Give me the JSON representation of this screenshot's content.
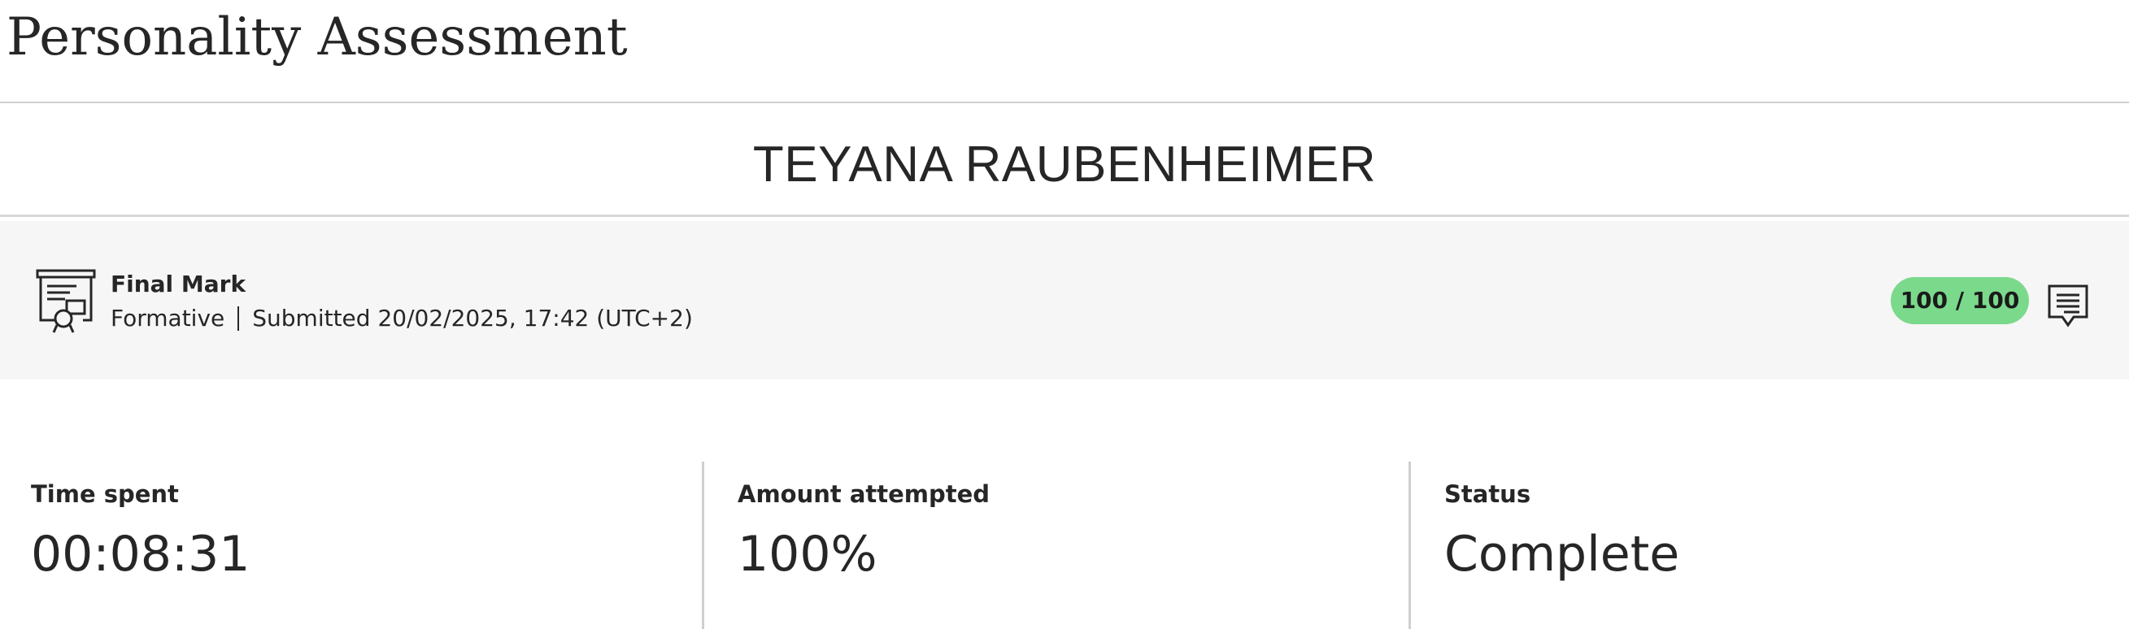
{
  "header": {
    "title": "Personality Assessment"
  },
  "student": {
    "name": "TEYANA RAUBENHEIMER"
  },
  "final_mark": {
    "title": "Final Mark",
    "type": "Formative",
    "submitted": "Submitted 20/02/2025, 17:42 (UTC+2)",
    "score": "100 / 100",
    "score_color": "#7bd98b",
    "icon": "certificate-icon",
    "feedback_icon": "feedback-comment-icon"
  },
  "stats": [
    {
      "label": "Time spent",
      "value": "00:08:31"
    },
    {
      "label": "Amount attempted",
      "value": "100%"
    },
    {
      "label": "Status",
      "value": "Complete"
    }
  ]
}
